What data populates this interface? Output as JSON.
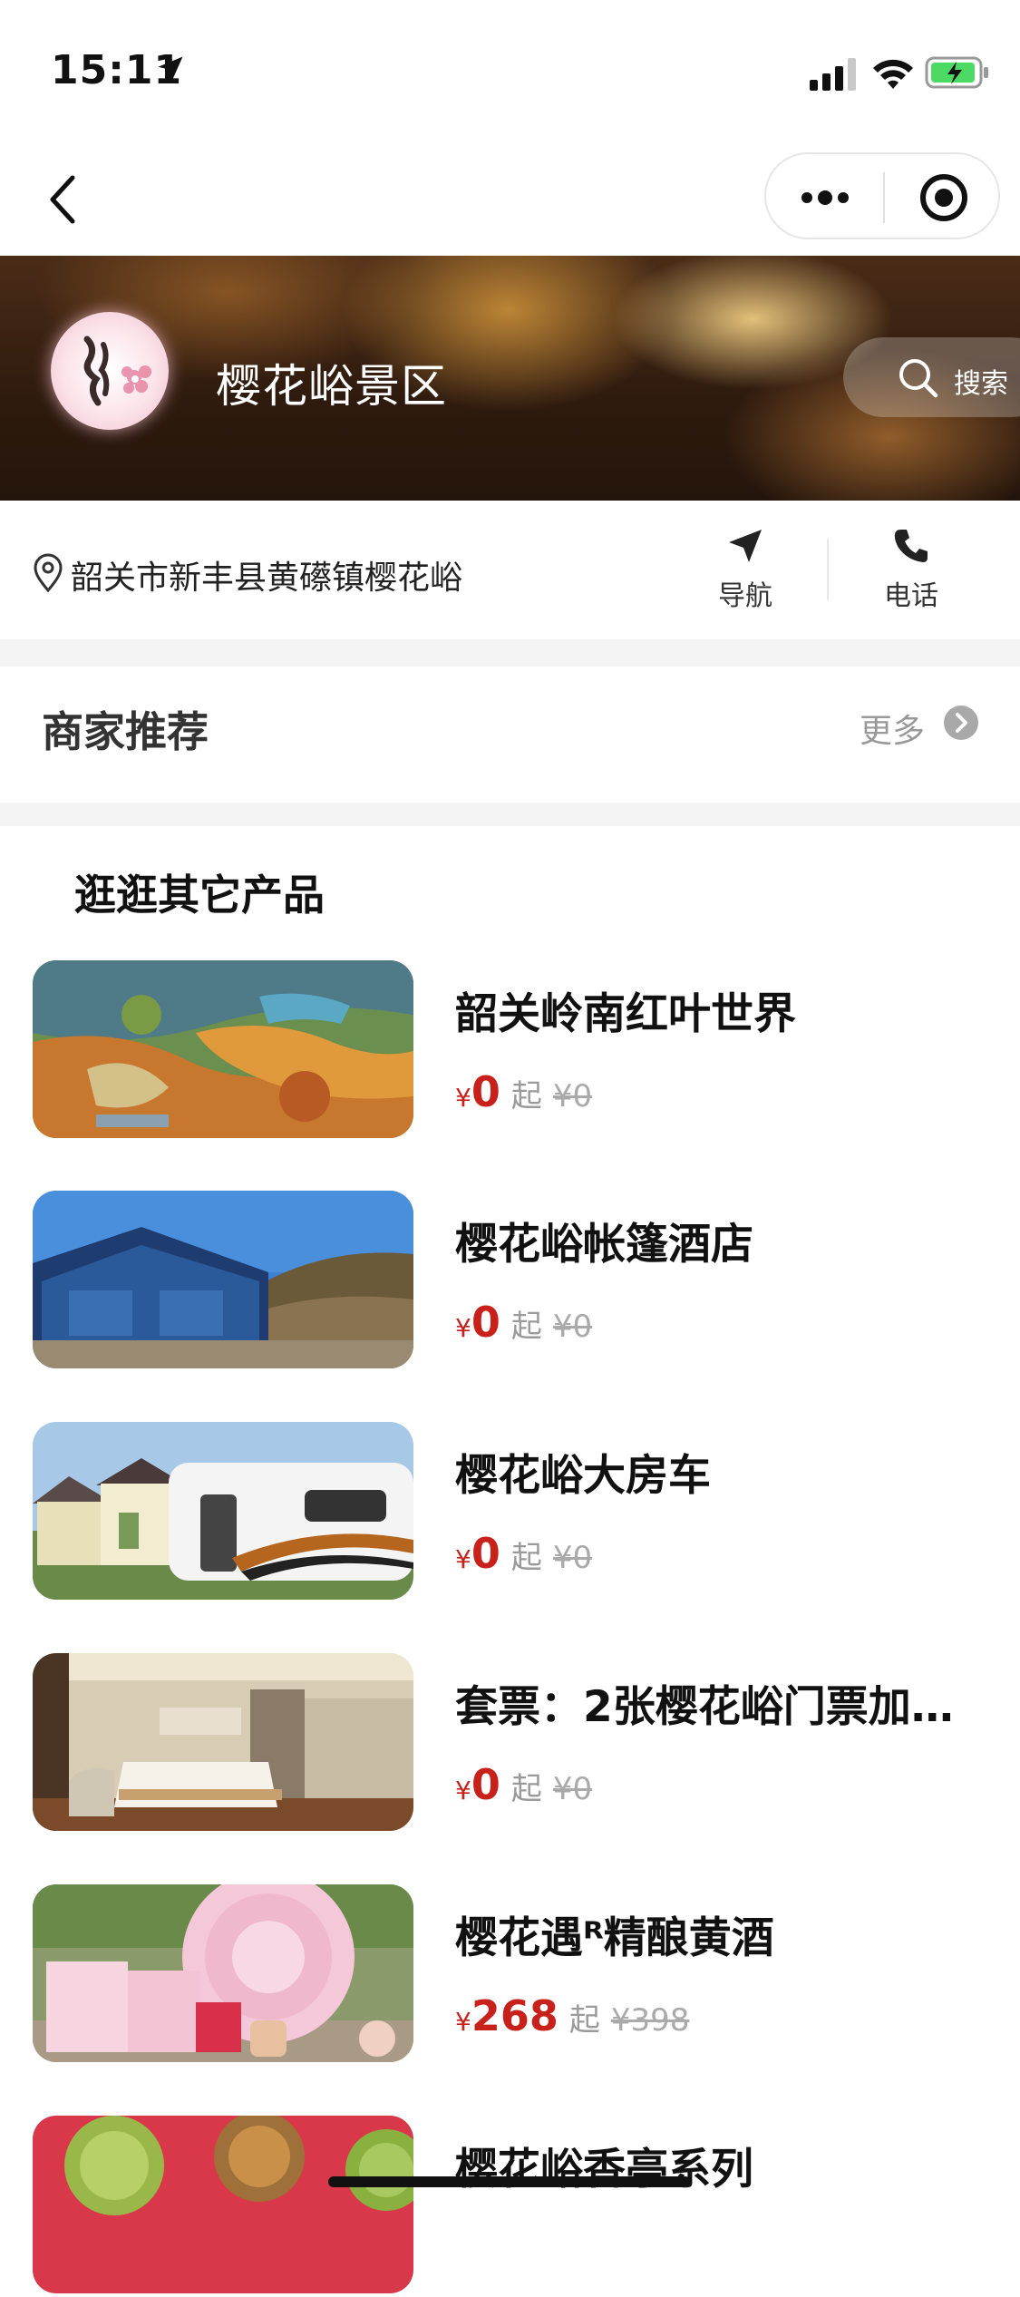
{
  "status_bar": {
    "time": "15:11"
  },
  "header": {
    "title": "樱花峪景区",
    "search_label": "搜索"
  },
  "address": {
    "text": "韶关市新丰县黄礤镇樱花峪",
    "nav_label": "导航",
    "phone_label": "电话"
  },
  "recommend": {
    "title": "商家推荐",
    "more_label": "更多"
  },
  "products": {
    "heading": "逛逛其它产品",
    "items": [
      {
        "name": "韶关岭南红叶世界",
        "currency": "¥",
        "price": "0",
        "from": "起",
        "original": "¥0"
      },
      {
        "name": "樱花峪帐篷酒店",
        "currency": "¥",
        "price": "0",
        "from": "起",
        "original": "¥0"
      },
      {
        "name": "樱花峪大房车",
        "currency": "¥",
        "price": "0",
        "from": "起",
        "original": "¥0"
      },
      {
        "name": "套票：2张樱花峪门票加…",
        "currency": "¥",
        "price": "0",
        "from": "起",
        "original": "¥0"
      },
      {
        "name": "樱花遇ᴿ精酿黄酒",
        "currency": "¥",
        "price": "268",
        "from": "起",
        "original": "¥398"
      },
      {
        "name": "樱花峪香亭系列",
        "currency": "",
        "price": "",
        "from": "",
        "original": ""
      }
    ]
  },
  "colors": {
    "price_red": "#c8201a",
    "accent_gray": "#999999",
    "banner_dark": "#2e1a0e"
  },
  "icons": [
    "location-arrow-icon",
    "signal-icon",
    "wifi-icon",
    "battery-icon",
    "back-icon",
    "more-dots-icon",
    "target-icon",
    "search-icon",
    "pin-icon",
    "navigate-icon",
    "phone-icon",
    "chevron-right-icon"
  ]
}
